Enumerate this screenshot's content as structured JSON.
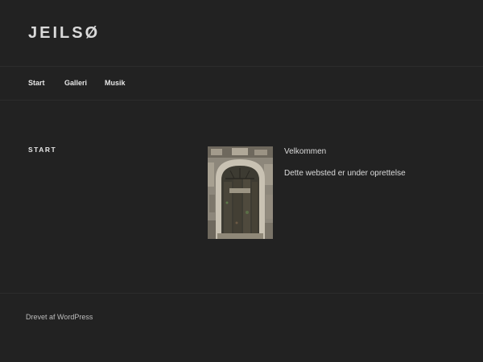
{
  "site": {
    "title": "JEILSØ"
  },
  "nav": {
    "items": [
      {
        "label": "Start"
      },
      {
        "label": "Galleri"
      },
      {
        "label": "Musik"
      }
    ]
  },
  "main": {
    "page_title": "START",
    "welcome": "Velkommen",
    "construction_notice": "Dette websted er under oprettelse",
    "image_subject": "old-arched-wooden-door"
  },
  "footer": {
    "credit": "Drevet af WordPress"
  },
  "colors": {
    "background": "#222222",
    "divider": "#2c2c2c",
    "text": "#dcdcdc",
    "title": "#dadada"
  }
}
